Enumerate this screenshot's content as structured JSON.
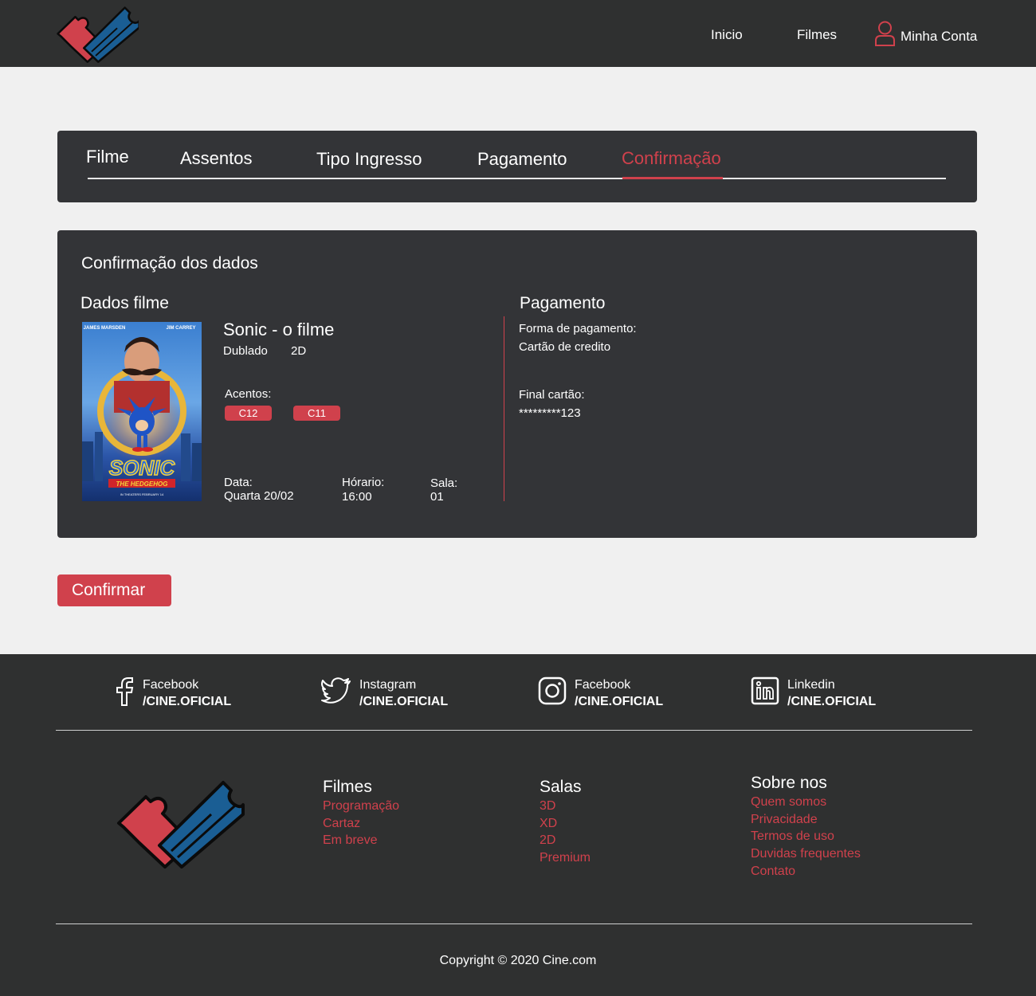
{
  "header": {
    "nav": {
      "inicio": "Inicio",
      "filmes": "Filmes",
      "account": "Minha Conta"
    }
  },
  "steps": [
    {
      "label": "Filme"
    },
    {
      "label": "Assentos"
    },
    {
      "label": "Tipo Ingresso"
    },
    {
      "label": "Pagamento"
    },
    {
      "label": "Confirmação",
      "active": true
    }
  ],
  "panel": {
    "title": "Confirmação dos dados",
    "movie_section_title": "Dados filme",
    "movie": {
      "title": "Sonic - o filme",
      "dub": "Dublado",
      "format": "2D",
      "poster": {
        "actor_left": "JAMES MARSDEN",
        "actor_right": "JIM CARREY",
        "logo": "SONIC",
        "subtitle": "THE HEDGEHOG",
        "release": "IN THEATERS FEBRUARY 14"
      }
    },
    "seats_label": "Acentos:",
    "seats": [
      "C12",
      "C11"
    ],
    "date_label": "Data:",
    "date_value": "Quarta 20/02",
    "time_label": "Hórario:",
    "time_value": "16:00",
    "room_label": "Sala:",
    "room_value": "01",
    "payment_section_title": "Pagamento",
    "payment_method_label": "Forma de pagamento:",
    "payment_method_value": "Cartão de credito",
    "card_label": "Final cartão:",
    "card_value": "*********123"
  },
  "confirm_button": "Confirmar",
  "footer": {
    "social": [
      {
        "icon": "facebook-icon",
        "network": "Facebook",
        "handle": "/CINE.OFICIAL"
      },
      {
        "icon": "twitter-icon",
        "network": "Instagram",
        "handle": "/CINE.OFICIAL"
      },
      {
        "icon": "instagram-icon",
        "network": "Facebook",
        "handle": "/CINE.OFICIAL"
      },
      {
        "icon": "linkedin-icon",
        "network": "Linkedin",
        "handle": "/CINE.OFICIAL"
      }
    ],
    "columns": [
      {
        "title": "Filmes",
        "links": [
          "Programação",
          "Cartaz",
          "Em breve"
        ]
      },
      {
        "title": "Salas",
        "links": [
          "3D",
          "XD",
          "2D",
          "Premium"
        ]
      },
      {
        "title": "Sobre nos",
        "links": [
          "Quem somos",
          "Privacidade",
          "Termos de uso",
          "Duvidas frequentes",
          "Contato"
        ]
      }
    ],
    "copyright": "Copyright © 2020 Cine.com"
  },
  "colors": {
    "accent": "#d0414c",
    "ticket_blue": "#1a5e94",
    "header_bg": "#2f3030",
    "panel_bg": "#333437",
    "page_bg": "#f0f0f0"
  }
}
